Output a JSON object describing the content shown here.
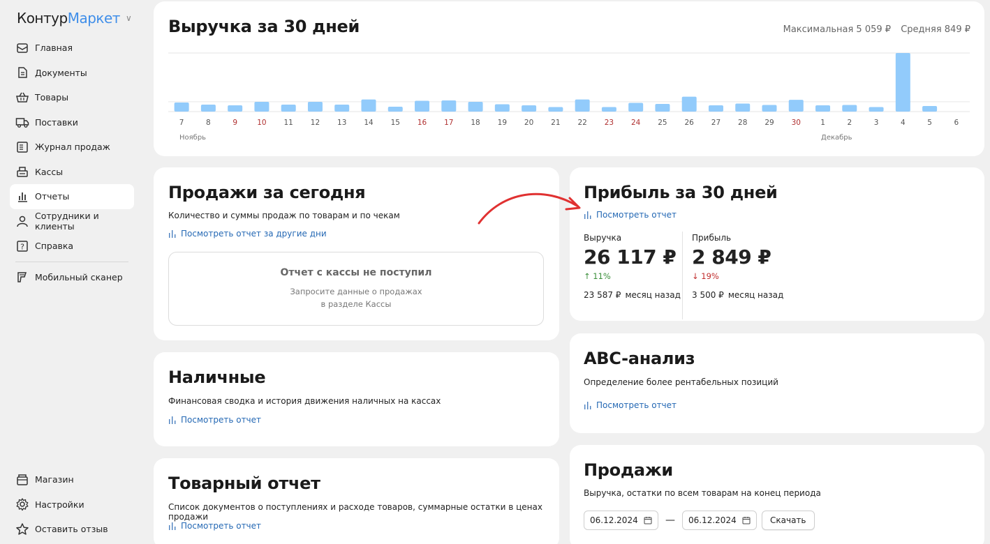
{
  "logo": {
    "part1": "Контур",
    "part2": "Маркет"
  },
  "sidebar": {
    "items": [
      {
        "label": "Главная",
        "icon": "mail-icon"
      },
      {
        "label": "Документы",
        "icon": "document-icon"
      },
      {
        "label": "Товары",
        "icon": "basket-icon"
      },
      {
        "label": "Поставки",
        "icon": "truck-icon"
      },
      {
        "label": "Журнал продаж",
        "icon": "journal-icon"
      },
      {
        "label": "Кассы",
        "icon": "cash-register-icon"
      },
      {
        "label": "Отчеты",
        "icon": "chart-icon",
        "active": true
      },
      {
        "label": "Сотрудники и клиенты",
        "icon": "user-icon"
      },
      {
        "label": "Справка",
        "icon": "help-icon"
      }
    ],
    "scanner": "Мобильный сканер",
    "bottom": [
      {
        "label": "Магазин",
        "icon": "store-icon"
      },
      {
        "label": "Настройки",
        "icon": "gear-icon"
      },
      {
        "label": "Оставить отзыв",
        "icon": "star-icon"
      }
    ]
  },
  "revenue": {
    "title": "Выручка за 30 дней",
    "max_label": "Максимальная 5 059 ₽",
    "avg_label": "Средняя 849 ₽",
    "month1": "Ноябрь",
    "month2": "Декабрь"
  },
  "chart_data": {
    "type": "bar",
    "categories": [
      "7",
      "8",
      "9",
      "10",
      "11",
      "12",
      "13",
      "14",
      "15",
      "16",
      "17",
      "18",
      "19",
      "20",
      "21",
      "22",
      "23",
      "24",
      "25",
      "26",
      "27",
      "28",
      "29",
      "30",
      "1",
      "2",
      "3",
      "4",
      "5",
      "6"
    ],
    "values": [
      780,
      600,
      540,
      840,
      600,
      840,
      600,
      1050,
      420,
      930,
      960,
      840,
      630,
      540,
      390,
      1050,
      390,
      750,
      660,
      1290,
      540,
      690,
      570,
      1020,
      540,
      570,
      390,
      5059,
      480,
      0
    ],
    "weekend_categories": [
      "9",
      "10",
      "16",
      "17",
      "23",
      "24",
      "30"
    ],
    "max": 5059,
    "average": 849,
    "bar_color": "#92cbfb",
    "weekend_color": "#b03030"
  },
  "today": {
    "title": "Продажи за сегодня",
    "desc": "Количество и суммы продаж по товарам и по чекам",
    "link": "Посмотреть отчет за другие дни",
    "empty_title": "Отчет с кассы не поступил",
    "empty_line1": "Запросите данные о продажах",
    "empty_line2": "в разделе Кассы"
  },
  "cash": {
    "title": "Наличные",
    "desc": "Финансовая сводка и история движения наличных на кассах",
    "link": "Посмотреть отчет"
  },
  "goods": {
    "title": "Товарный отчет",
    "desc": "Список документов о поступлениях и расходе товаров, суммарные остатки в ценах продажи",
    "link": "Посмотреть отчет"
  },
  "profit": {
    "title": "Прибыль за 30 дней",
    "link": "Посмотреть отчет",
    "revenue_label": "Выручка",
    "revenue_value": "26 117 ₽",
    "revenue_change": "11%",
    "revenue_prev": "23 587 ₽",
    "profit_label": "Прибыль",
    "profit_value": "2 849 ₽",
    "profit_change": "19%",
    "profit_prev": "3 500 ₽",
    "prev_suffix": "месяц назад"
  },
  "abc": {
    "title": "ABC-анализ",
    "desc": "Определение более рентабельных позиций",
    "link": "Посмотреть отчет"
  },
  "sales": {
    "title": "Продажи",
    "desc": "Выручка, остатки по всем товарам на конец периода",
    "date_from": "06.12.2024",
    "date_to": "06.12.2024",
    "download": "Скачать"
  }
}
